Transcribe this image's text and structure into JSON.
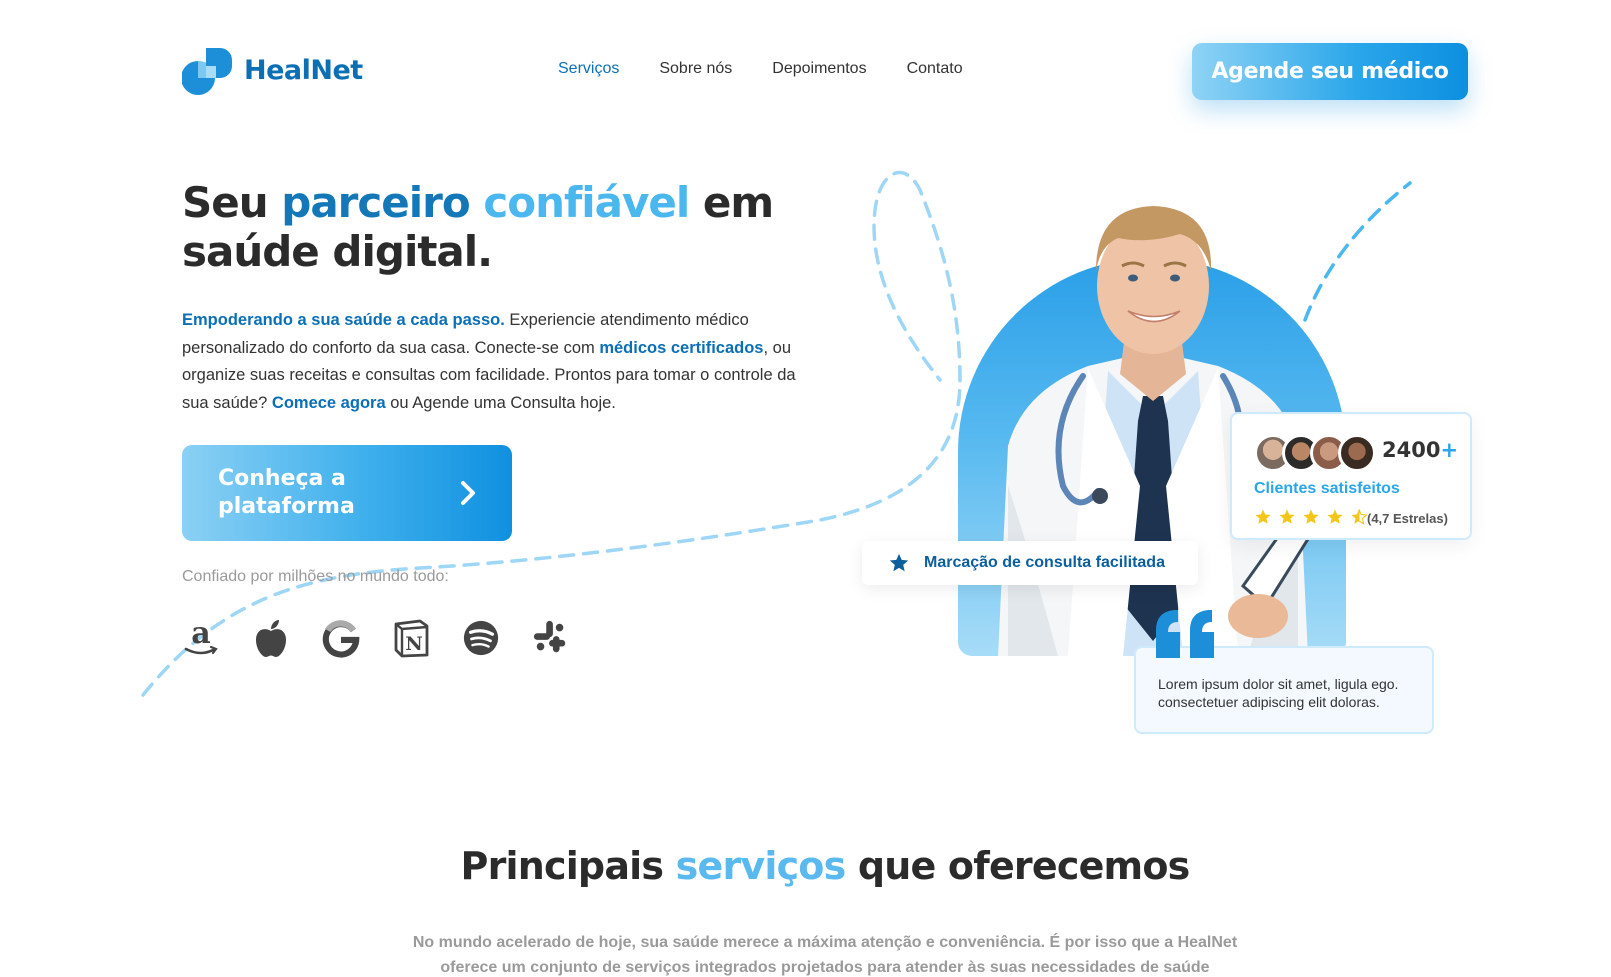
{
  "brand": {
    "name": "HealNet"
  },
  "nav": {
    "items": [
      {
        "label": "Serviços"
      },
      {
        "label": "Sobre nós"
      },
      {
        "label": "Depoimentos"
      },
      {
        "label": "Contato"
      }
    ],
    "cta_label": "Agende seu médico"
  },
  "hero": {
    "title_part1": "Seu ",
    "title_part2": "parceiro",
    "title_part3": "confiável",
    "title_part4": " em saúde digital.",
    "text_lead": "Empoderando a sua saúde a cada passo.",
    "text_1": " Experiencie atendimento médico personalizado do conforto da sua casa. Conecte-se com ",
    "text_link1": "médicos certificados",
    "text_2": ", ou organize suas receitas e consultas com facilidade. Prontos para tomar o controle da sua saúde? ",
    "text_link2": "Comece agora",
    "text_3": " ou Agende uma Consulta hoje.",
    "button_label": "Conheça a plataforma",
    "trusted_label": "Confiado por milhões no mundo todo:"
  },
  "logos": [
    "amazon-icon",
    "apple-icon",
    "google-icon",
    "notion-icon",
    "spotify-icon",
    "slack-icon"
  ],
  "clients_card": {
    "count": "2400",
    "plus": "+",
    "label": "Clientes satisfeitos",
    "rating_text": "(4,7 Estrelas)",
    "rating_value": 4.7
  },
  "consult_badge": {
    "label": "Marcação de consulta facilitada"
  },
  "quote_card": {
    "text": "Lorem ipsum dolor sit amet, ligula ego. consectetuer adipiscing elit doloras."
  },
  "services": {
    "title_part1": "Principais ",
    "title_part2": "serviços",
    "title_part3": " que oferecemos",
    "text": "No mundo acelerado de hoje, sua saúde merece a máxima atenção e conveniência. É por isso que a HealNet oferece um conjunto de serviços integrados projetados para atender às suas necessidades de saúde"
  },
  "colors": {
    "primary": "#0b6fb6",
    "accent": "#2aa6ea",
    "light_accent": "#8fd3f5",
    "star": "#f5c518"
  }
}
